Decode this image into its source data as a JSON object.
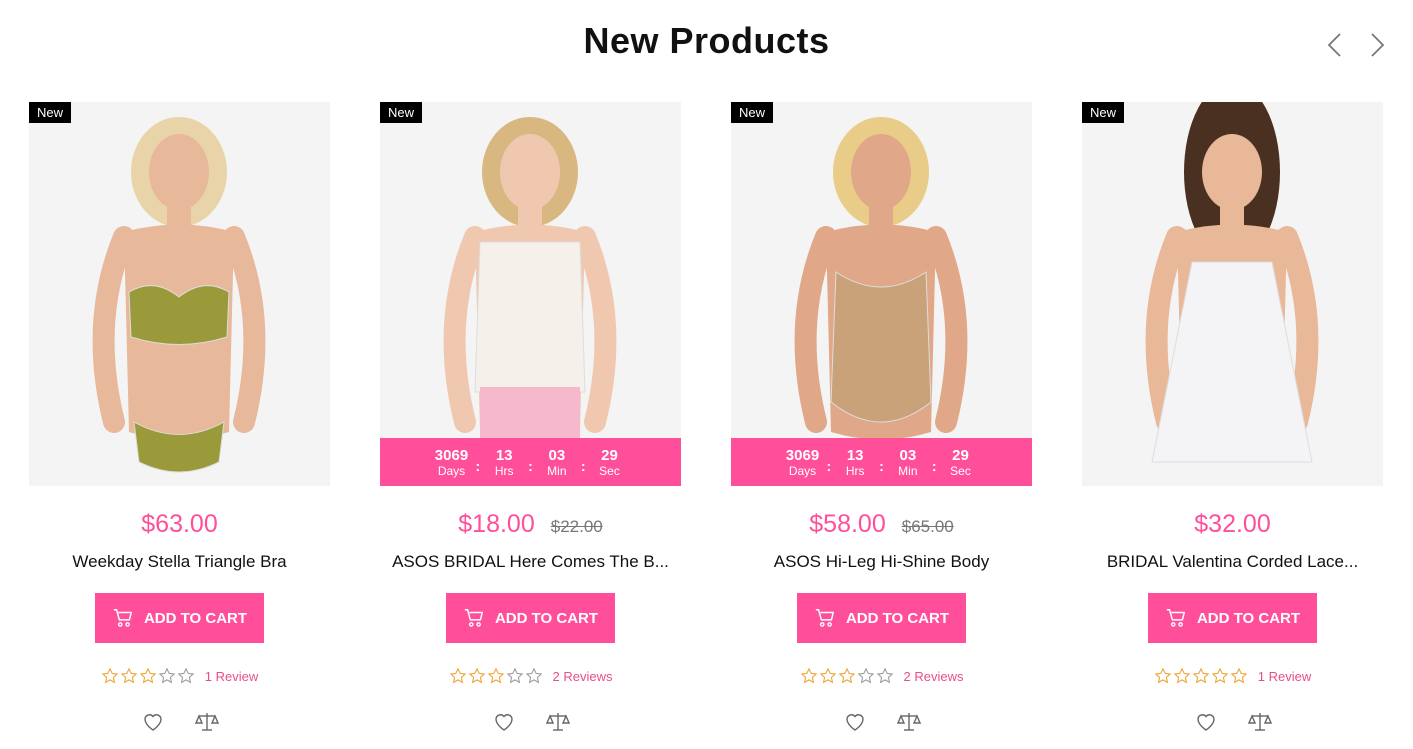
{
  "section": {
    "title": "New Products"
  },
  "colors": {
    "accent": "#ff4f9a",
    "badge": "#000000",
    "star": "#f0a030",
    "muted": "#777777"
  },
  "icons": {
    "prev": "chevron-left-icon",
    "next": "chevron-right-icon",
    "cart": "cart-icon",
    "wishlist": "heart-icon",
    "compare": "scale-icon",
    "star": "star-outline-icon"
  },
  "products": [
    {
      "badge": "New",
      "price": "$63.00",
      "old_price": "",
      "name": "Weekday Stella Triangle Bra",
      "add_to_cart": "ADD TO CART",
      "rating": 3,
      "reviews": "1 Review",
      "countdown": null,
      "image": {
        "description_icon": "product-photo",
        "garment_color": "#9a9a3a",
        "skin": "#e8b89a",
        "hair": "#e8d4a8"
      }
    },
    {
      "badge": "New",
      "price": "$18.00",
      "old_price": "$22.00",
      "name": "ASOS BRIDAL Here Comes The B...",
      "add_to_cart": "ADD TO CART",
      "rating": 3,
      "reviews": "2 Reviews",
      "countdown": {
        "days": "3069",
        "days_label": "Days",
        "hrs": "13",
        "hrs_label": "Hrs",
        "min": "03",
        "min_label": "Min",
        "sec": "29",
        "sec_label": "Sec"
      },
      "image": {
        "description_icon": "product-photo",
        "garment_color": "#f5f0ea",
        "skin": "#f0c8b0",
        "hair": "#d8b880"
      }
    },
    {
      "badge": "New",
      "price": "$58.00",
      "old_price": "$65.00",
      "name": "ASOS Hi-Leg Hi-Shine Body",
      "add_to_cart": "ADD TO CART",
      "rating": 3,
      "reviews": "2 Reviews",
      "countdown": {
        "days": "3069",
        "days_label": "Days",
        "hrs": "13",
        "hrs_label": "Hrs",
        "min": "03",
        "min_label": "Min",
        "sec": "29",
        "sec_label": "Sec"
      },
      "image": {
        "description_icon": "product-photo",
        "garment_color": "#c9a27a",
        "skin": "#e0a888",
        "hair": "#e8cc88"
      }
    },
    {
      "badge": "New",
      "price": "$32.00",
      "old_price": "",
      "name": "BRIDAL Valentina Corded Lace...",
      "add_to_cart": "ADD TO CART",
      "rating": 5,
      "reviews": "1 Review",
      "countdown": null,
      "image": {
        "description_icon": "product-photo",
        "garment_color": "#f4f4f6",
        "skin": "#e8b898",
        "hair": "#4a3020"
      }
    }
  ]
}
